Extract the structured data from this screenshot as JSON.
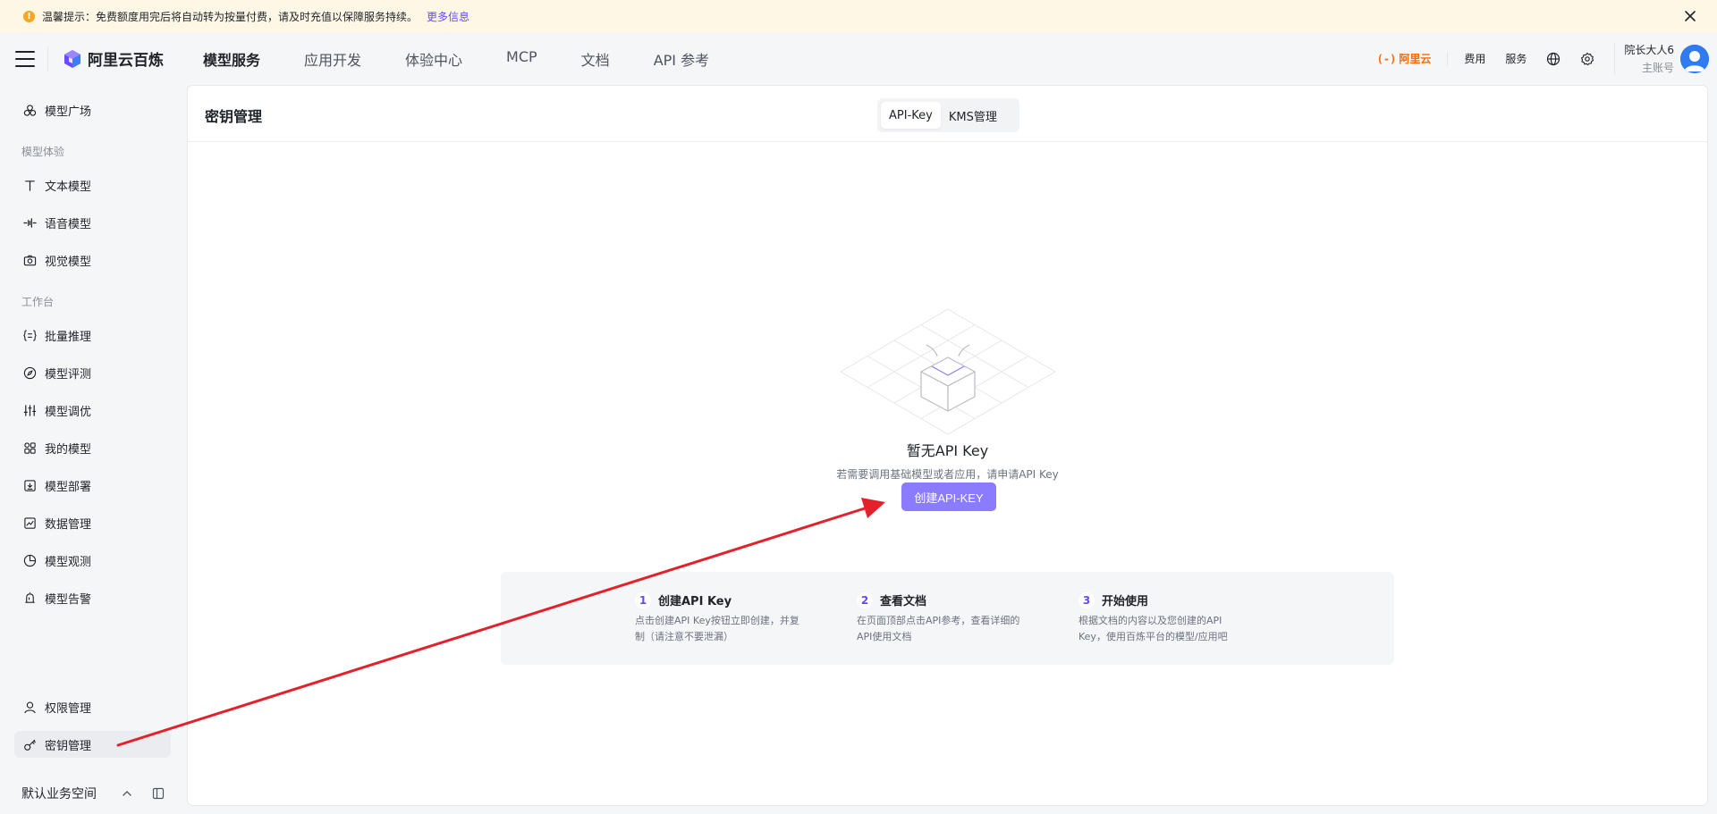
{
  "notice": {
    "text": "温馨提示：免费额度用完后将自动转为按量付费，请及时充值以保障服务持续。",
    "link": "更多信息"
  },
  "header": {
    "brand": "阿里云百炼",
    "nav": [
      "模型服务",
      "应用开发",
      "体验中心",
      "MCP",
      "文档",
      "API 参考"
    ],
    "active_nav": "模型服务",
    "aliyun_mark": "(-)",
    "aliyun_label": "阿里云",
    "links": [
      "费用",
      "服务"
    ],
    "user_name": "院长大人6",
    "user_type": "主账号"
  },
  "sidebar": {
    "model_square": "模型广场",
    "group_experience": "模型体验",
    "text_model": "文本模型",
    "voice_model": "语音模型",
    "vision_model": "视觉模型",
    "group_workbench": "工作台",
    "batch_inference": "批量推理",
    "model_eval": "模型评测",
    "model_tuning": "模型调优",
    "my_models": "我的模型",
    "model_deploy": "模型部署",
    "data_manage": "数据管理",
    "model_observe": "模型观测",
    "model_alert": "模型告警",
    "permission": "权限管理",
    "key_manage": "密钥管理",
    "workspace": "默认业务空间"
  },
  "main": {
    "title": "密钥管理",
    "tabs": [
      "API-Key",
      "KMS管理"
    ],
    "active_tab": "API-Key",
    "empty_title": "暂无API Key",
    "empty_desc": "若需要调用基础模型或者应用，请申请API Key",
    "create_button": "创建API-KEY",
    "steps": [
      {
        "num": "1",
        "title": "创建API Key",
        "desc_line1": "点击创建API Key按钮立即创建，并复",
        "desc_line2": "制（请注意不要泄漏）"
      },
      {
        "num": "2",
        "title": "查看文档",
        "desc_line1": "在页面顶部点击API参考，查看详细的",
        "desc_line2": "API使用文档"
      },
      {
        "num": "3",
        "title": "开始使用",
        "desc_line1": "根据文档的内容以及您创建的API",
        "desc_line2": "Key，使用百炼平台的模型/应用吧"
      }
    ]
  },
  "colors": {
    "accent": "#624aff",
    "button": "#8a7bff",
    "annotation_arrow": "#e3212b",
    "aliyun_orange": "#ff6a00",
    "notice_bg": "#fef7e6"
  }
}
